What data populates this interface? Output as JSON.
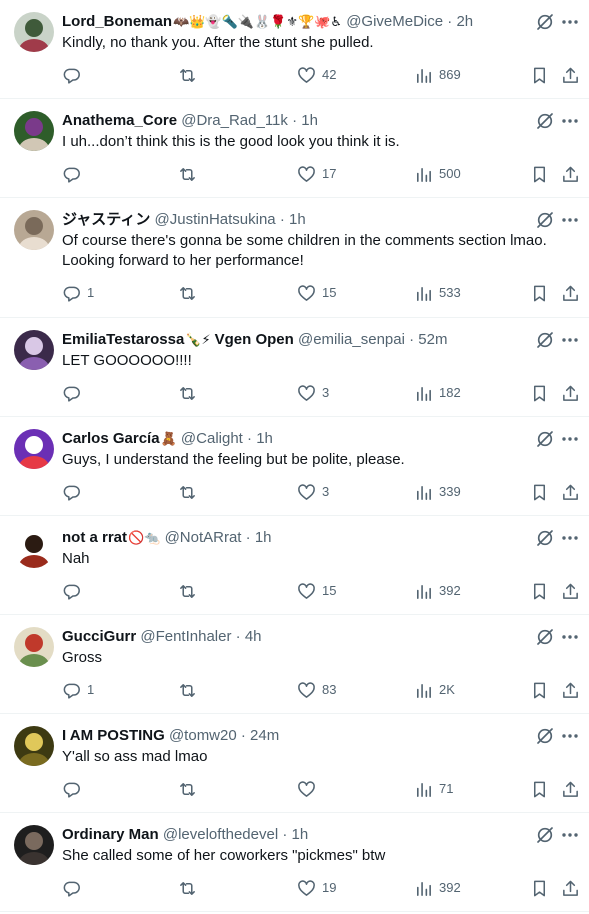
{
  "icons": {
    "grok": "grok-icon",
    "more": "more-icon",
    "reply": "reply-icon",
    "retweet": "retweet-icon",
    "like": "like-icon",
    "views": "views-icon",
    "bookmark": "bookmark-icon",
    "share": "share-icon"
  },
  "colors": {
    "text": "#0f1419",
    "muted": "#536471",
    "divider": "#eff3f4"
  },
  "tweets": [
    {
      "display_name": "Lord_Boneman",
      "name_emoji": "🦇👑👻🔦🔌🐰🌹⚜🏆🐙♿",
      "handle": "@GiveMeDice",
      "dot": "·",
      "time": "2h",
      "text": "Kindly, no thank you. After the stunt she pulled.",
      "replies": "",
      "retweets": "",
      "likes": "42",
      "views": "869",
      "avatar_colors": [
        "#c9d3c8",
        "#3f5a3a",
        "#a03b4a"
      ]
    },
    {
      "display_name": "Anathema_Core",
      "name_emoji": "",
      "handle": "@Dra_Rad_11k",
      "dot": "·",
      "time": "1h",
      "text": "I uh...don’t think this is the good look you think it is.",
      "replies": "",
      "retweets": "",
      "likes": "17",
      "views": "500",
      "avatar_colors": [
        "#2e5d2a",
        "#7a3a8a",
        "#d1c7b5"
      ]
    },
    {
      "display_name": "ジャスティン",
      "name_emoji": "",
      "handle": "@JustinHatsukina",
      "dot": "·",
      "time": "1h",
      "text": "Of course there's gonna be some children in the comments section lmao. Looking forward to her performance!",
      "replies": "1",
      "retweets": "",
      "likes": "15",
      "views": "533",
      "avatar_colors": [
        "#b8a894",
        "#7a6a5a",
        "#e8ddd0"
      ]
    },
    {
      "display_name": "EmiliaTestarossa",
      "name_emoji": "🍾⚡",
      "name_suffix": "Vgen Open",
      "handle": "@emilia_senpai",
      "dot": "·",
      "time": "52m",
      "text": "LET GOOOOOO!!!!",
      "replies": "",
      "retweets": "",
      "likes": "3",
      "views": "182",
      "avatar_colors": [
        "#3b2a4a",
        "#d9c8e6",
        "#8a5fb0"
      ]
    },
    {
      "display_name": "Carlos García",
      "name_emoji": "🧸",
      "handle": "@Calight",
      "dot": "·",
      "time": "1h",
      "text": "Guys, I understand the feeling but be polite, please.",
      "replies": "",
      "retweets": "",
      "likes": "3",
      "views": "339",
      "avatar_colors": [
        "#6b2fb5",
        "#ffffff",
        "#e63946"
      ]
    },
    {
      "display_name": "not a rrat",
      "name_emoji": "🚫🐀",
      "handle": "@NotARrat",
      "dot": "·",
      "time": "1h",
      "text": "Nah",
      "replies": "",
      "retweets": "",
      "likes": "15",
      "views": "392",
      "avatar_colors": [
        "#ffffff",
        "#2b1b12",
        "#9a2b1c"
      ]
    },
    {
      "display_name": "GucciGurr",
      "name_emoji": "",
      "handle": "@FentInhaler",
      "dot": "·",
      "time": "4h",
      "text": "Gross",
      "replies": "1",
      "retweets": "",
      "likes": "83",
      "views": "2K",
      "avatar_colors": [
        "#e3dcc5",
        "#c0392b",
        "#6a8f4e"
      ]
    },
    {
      "display_name": "I AM POSTING",
      "name_emoji": "",
      "handle": "@tomw20",
      "dot": "·",
      "time": "24m",
      "text": "Y'all so ass mad lmao",
      "replies": "",
      "retweets": "",
      "likes": "",
      "views": "71",
      "avatar_colors": [
        "#3d3a12",
        "#e0c85a",
        "#7a6b20"
      ]
    },
    {
      "display_name": "Ordinary Man",
      "name_emoji": "",
      "handle": "@levelofthedevel",
      "dot": "·",
      "time": "1h",
      "text": "She called some of her coworkers \"pickmes\" btw",
      "replies": "",
      "retweets": "",
      "likes": "19",
      "views": "392",
      "avatar_colors": [
        "#1e1e1e",
        "#7a6a5e",
        "#3a3330"
      ]
    }
  ]
}
